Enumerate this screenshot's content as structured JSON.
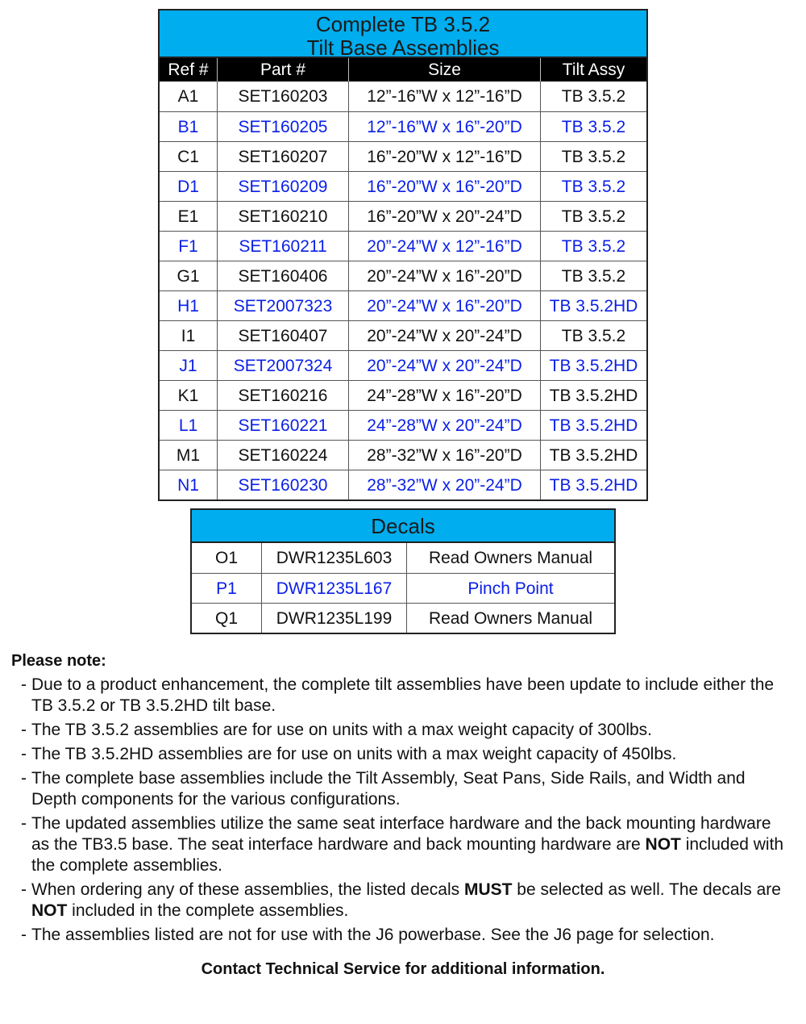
{
  "main_table": {
    "title_line1": "Complete TB 3.5.2",
    "title_line2": "Tilt Base Assemblies",
    "headers": [
      "Ref #",
      "Part #",
      "Size",
      "Tilt Assy"
    ],
    "rows": [
      {
        "ref": "A1",
        "part": "SET160203",
        "size": "12”-16”W x 12”-16”D",
        "tilt": "TB 3.5.2",
        "color": "black"
      },
      {
        "ref": "B1",
        "part": "SET160205",
        "size": "12”-16”W x 16”-20”D",
        "tilt": "TB 3.5.2",
        "color": "blue"
      },
      {
        "ref": "C1",
        "part": "SET160207",
        "size": "16”-20”W x 12”-16”D",
        "tilt": "TB 3.5.2",
        "color": "black"
      },
      {
        "ref": "D1",
        "part": "SET160209",
        "size": "16”-20”W x 16”-20”D",
        "tilt": "TB 3.5.2",
        "color": "blue"
      },
      {
        "ref": "E1",
        "part": "SET160210",
        "size": "16”-20”W x 20”-24”D",
        "tilt": "TB 3.5.2",
        "color": "black"
      },
      {
        "ref": "F1",
        "part": "SET160211",
        "size": "20”-24”W x 12”-16”D",
        "tilt": "TB 3.5.2",
        "color": "blue"
      },
      {
        "ref": "G1",
        "part": "SET160406",
        "size": "20”-24”W x 16”-20”D",
        "tilt": "TB 3.5.2",
        "color": "black"
      },
      {
        "ref": "H1",
        "part": "SET2007323",
        "size": "20”-24”W x 16”-20”D",
        "tilt": "TB 3.5.2HD",
        "color": "blue"
      },
      {
        "ref": "I1",
        "part": "SET160407",
        "size": "20”-24”W x 20”-24”D",
        "tilt": "TB 3.5.2",
        "color": "black"
      },
      {
        "ref": "J1",
        "part": "SET2007324",
        "size": "20”-24”W x 20”-24”D",
        "tilt": "TB 3.5.2HD",
        "color": "blue"
      },
      {
        "ref": "K1",
        "part": "SET160216",
        "size": "24”-28”W x 16”-20”D",
        "tilt": "TB 3.5.2HD",
        "color": "black"
      },
      {
        "ref": "L1",
        "part": "SET160221",
        "size": "24”-28”W x 20”-24”D",
        "tilt": "TB 3.5.2HD",
        "color": "blue"
      },
      {
        "ref": "M1",
        "part": "SET160224",
        "size": "28”-32”W x 16”-20”D",
        "tilt": "TB 3.5.2HD",
        "color": "black"
      },
      {
        "ref": "N1",
        "part": "SET160230",
        "size": "28”-32”W x 20”-24”D",
        "tilt": "TB 3.5.2HD",
        "color": "blue"
      }
    ]
  },
  "decals_table": {
    "title": "Decals",
    "rows": [
      {
        "ref": "O1",
        "part": "DWR1235L603",
        "desc": "Read Owners Manual",
        "color": "black"
      },
      {
        "ref": "P1",
        "part": "DWR1235L167",
        "desc": "Pinch Point",
        "color": "blue"
      },
      {
        "ref": "Q1",
        "part": "DWR1235L199",
        "desc": "Read Owners Manual",
        "color": "black"
      }
    ]
  },
  "notes": {
    "heading": "Please note:",
    "dash": "-",
    "items": [
      {
        "parts": [
          {
            "t": "Due to a product enhancement, the complete tilt assemblies have been update to include either the TB 3.5.2 or TB 3.5.2HD tilt base.",
            "b": false
          }
        ]
      },
      {
        "parts": [
          {
            "t": "The TB 3.5.2 assemblies are for use on units with a max weight capacity of 300lbs.",
            "b": false
          }
        ]
      },
      {
        "parts": [
          {
            "t": "The TB 3.5.2HD assemblies are for use on units with a max weight capacity of 450lbs.",
            "b": false
          }
        ]
      },
      {
        "parts": [
          {
            "t": "The complete base assemblies include the Tilt Assembly, Seat Pans, Side Rails, and Width and Depth components for the various configurations.",
            "b": false
          }
        ]
      },
      {
        "parts": [
          {
            "t": "The updated assemblies utilize the same seat interface hardware and the back mounting hardware as the TB3.5 base. The seat interface hardware and back mounting hardware are ",
            "b": false
          },
          {
            "t": "NOT",
            "b": true
          },
          {
            "t": " included with the complete assemblies.",
            "b": false
          }
        ]
      },
      {
        "parts": [
          {
            "t": "When ordering any of these assemblies, the listed decals ",
            "b": false
          },
          {
            "t": "MUST",
            "b": true
          },
          {
            "t": " be selected as well. The decals are ",
            "b": false
          },
          {
            "t": "NOT",
            "b": true
          },
          {
            "t": " included in the complete assemblies.",
            "b": false
          }
        ]
      },
      {
        "parts": [
          {
            "t": "The assemblies listed are not for use with the J6 powerbase. See the J6 page for selection.",
            "b": false
          }
        ]
      }
    ]
  },
  "contact": "Contact Technical Service for additional information.",
  "colors": {
    "header_blue": "#00adee",
    "highlight_text": "#0a1fe6",
    "header_black": "#000000"
  }
}
